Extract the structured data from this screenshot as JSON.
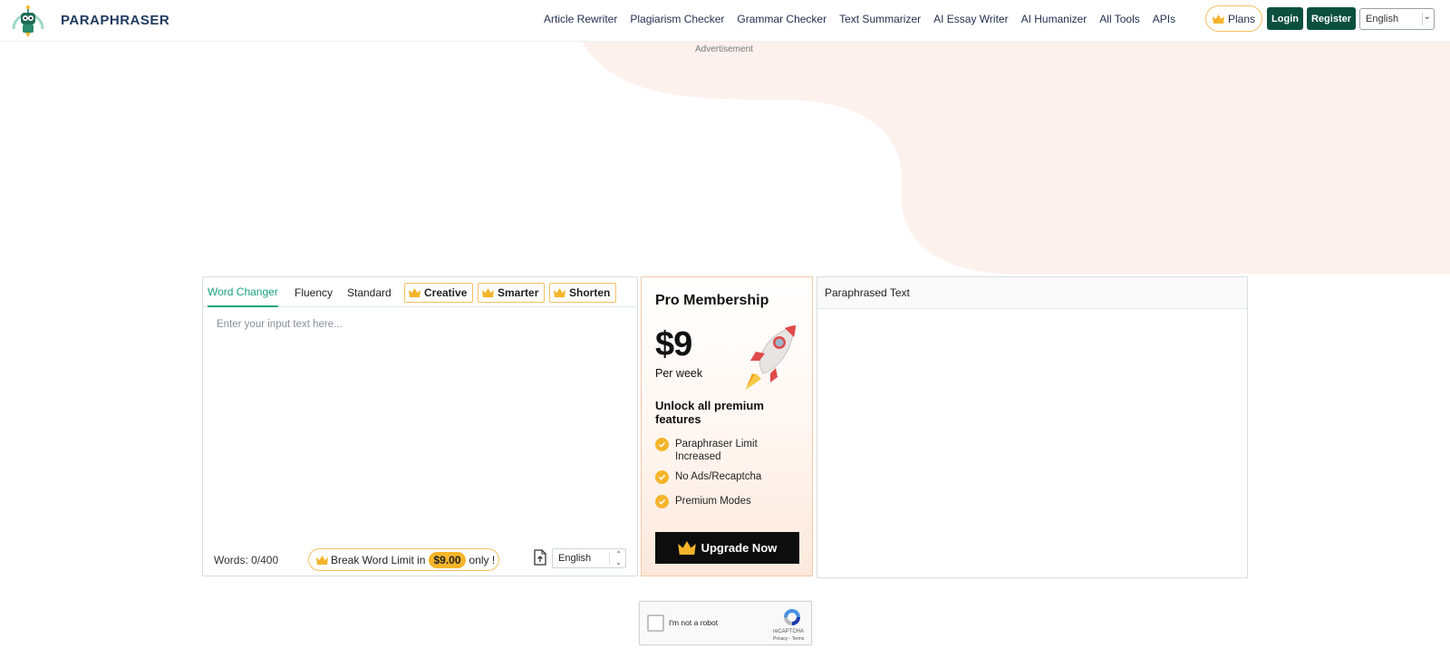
{
  "header": {
    "brand": "PARAPHRASER",
    "nav": [
      "Article Rewriter",
      "Plagiarism Checker",
      "Grammar Checker",
      "Text Summarizer",
      "AI Essay Writer",
      "AI Humanizer",
      "All Tools",
      "APIs"
    ],
    "plans_label": "Plans",
    "login_label": "Login",
    "register_label": "Register",
    "language": "English"
  },
  "advertisement_label": "Advertisement",
  "editor": {
    "tabs": [
      "Word Changer",
      "Fluency",
      "Standard"
    ],
    "active_tab": "Word Changer",
    "premium_tabs": [
      "Creative",
      "Smarter",
      "Shorten"
    ],
    "input_placeholder": "Enter your input text here...",
    "word_count": "Words: 0/400",
    "break_limit_prefix": "Break Word Limit in",
    "break_limit_price": "$9.00",
    "break_limit_suffix": "only !",
    "input_language": "English"
  },
  "pro": {
    "title": "Pro Membership",
    "price": "$9",
    "period": "Per week",
    "unlock_heading": "Unlock all premium features",
    "features": [
      "Paraphraser Limit Increased",
      "No Ads/Recaptcha",
      "Premium Modes"
    ],
    "upgrade_label": "Upgrade Now"
  },
  "output": {
    "heading": "Paraphrased Text"
  },
  "captcha": {
    "label": "I'm not a robot",
    "brand": "reCAPTCHA",
    "terms": "Privacy - Terms"
  },
  "colors": {
    "primary_green": "#0b4f3f",
    "accent_green": "#1aa37a",
    "gold": "#f5b42a",
    "blob": "#fdf1ed"
  }
}
